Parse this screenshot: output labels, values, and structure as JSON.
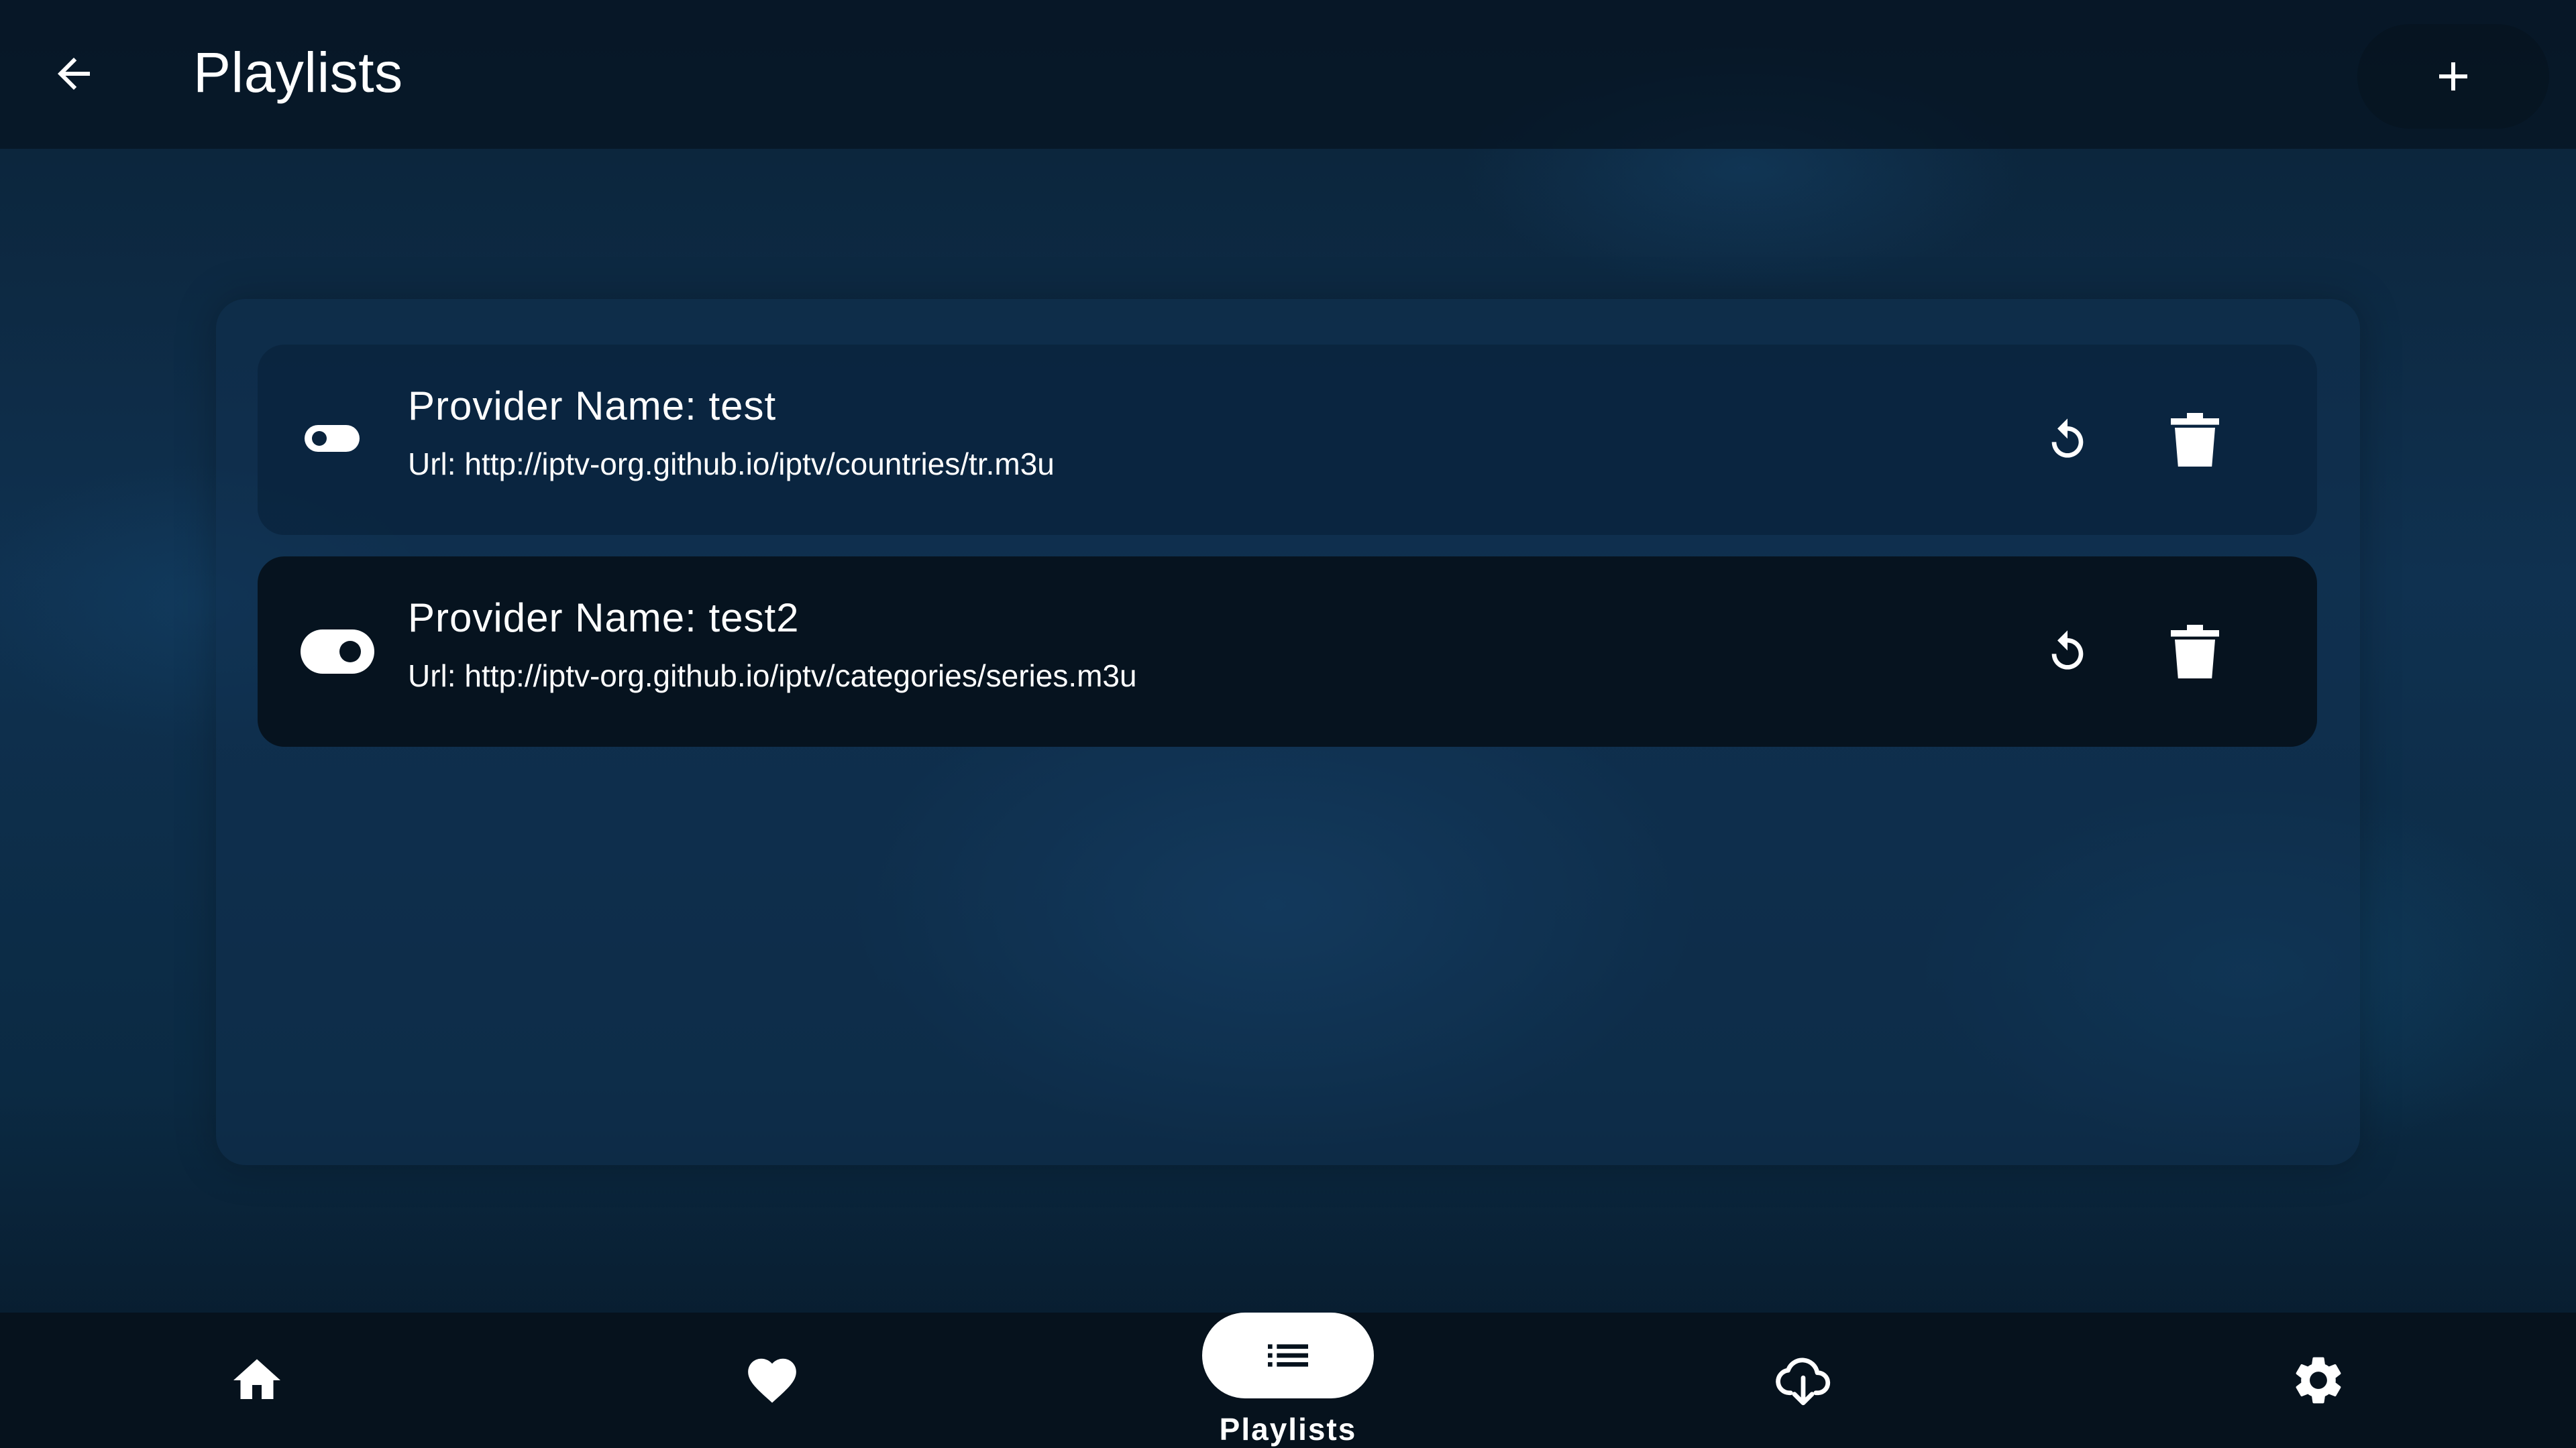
{
  "header": {
    "title": "Playlists",
    "back_icon": "arrow-left-icon",
    "add_icon": "plus-icon"
  },
  "playlists": [
    {
      "provider_name": "Provider Name: test",
      "url": "Url: http://iptv-org.github.io/iptv/countries/tr.m3u",
      "enabled": false
    },
    {
      "provider_name": "Provider Name: test2",
      "url": "Url: http://iptv-org.github.io/iptv/categories/series.m3u",
      "enabled": true
    }
  ],
  "bottom_nav": {
    "items": [
      {
        "icon": "home-icon"
      },
      {
        "icon": "heart-icon"
      },
      {
        "icon": "list-icon",
        "label": "Playlists",
        "active": true
      },
      {
        "icon": "cloud-download-icon"
      },
      {
        "icon": "gear-icon"
      }
    ]
  },
  "colors": {
    "foreground": "#ffffff",
    "row_selected_bg": "#06131f",
    "nav_bg": "#06121d"
  }
}
